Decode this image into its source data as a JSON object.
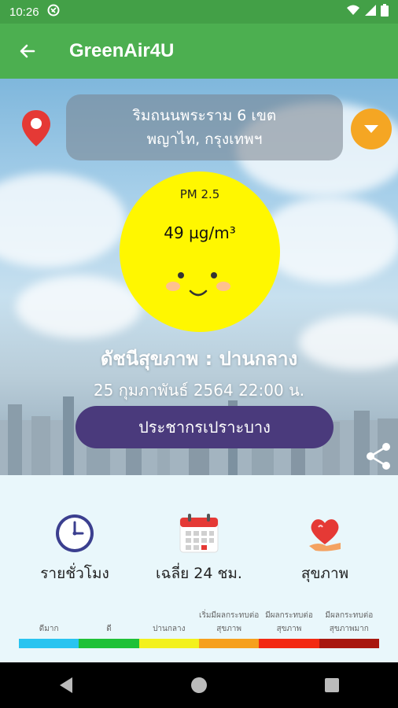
{
  "status_bar": {
    "time": "10:26"
  },
  "app_bar": {
    "title": "GreenAir4U"
  },
  "location": {
    "line1": "ริมถนนพระราม 6 เขต",
    "line2": "พญาไท, กรุงเทพฯ"
  },
  "air": {
    "pm_label": "PM 2.5",
    "pm_value": "49 µg/m³"
  },
  "health_index": "ดัชนีสุขภาพ : ปานกลาง",
  "datetime": "25 กุมภาพันธ์ 2564 22:00 น.",
  "risk_button": "ประชากรเปราะบาง",
  "menu": [
    {
      "label": "รายชั่วโมง",
      "icon": "clock-icon"
    },
    {
      "label": "เฉลี่ย 24 ชม.",
      "icon": "calendar-icon"
    },
    {
      "label": "สุขภาพ",
      "icon": "health-heart-icon"
    }
  ],
  "legend": {
    "labels": [
      "ดีมาก",
      "ดี",
      "ปานกลาง",
      "เริ่มมีผลกระทบต่อสุขภาพ",
      "มีผลกระทบต่อสุขภาพ",
      "มีผลกระทบต่อสุขภาพมาก"
    ],
    "colors": [
      "#29c4f0",
      "#1fc137",
      "#f3f11e",
      "#f6a01d",
      "#f32a12",
      "#a8180f"
    ]
  },
  "colors": {
    "accent": "#4caf50",
    "sun": "#fff700",
    "button": "#4a3a7c",
    "dropdown": "#f5a623"
  }
}
